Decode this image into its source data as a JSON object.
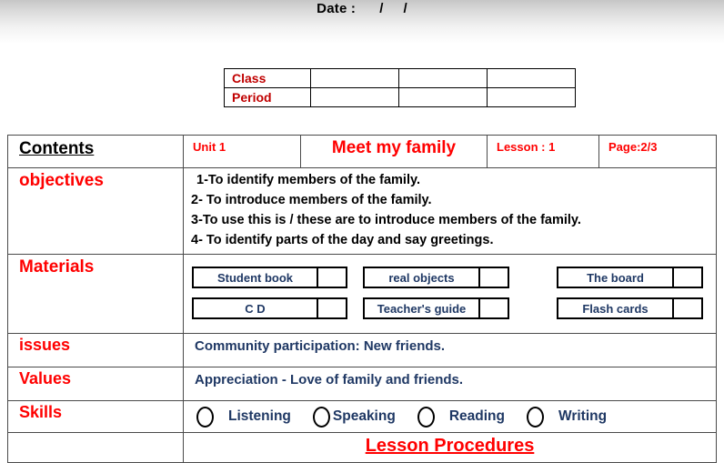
{
  "header": {
    "date_line": "Date :      /     /"
  },
  "class_table": {
    "rows": [
      {
        "label": "Class",
        "values": [
          "",
          "",
          ""
        ]
      },
      {
        "label": "Period",
        "values": [
          "",
          "",
          ""
        ]
      }
    ]
  },
  "lesson_table": {
    "contents_label": "Contents",
    "unit": "Unit 1",
    "title": "Meet my family",
    "lesson": "Lesson : 1",
    "page": "Page:2/3",
    "objectives_label": "objectives",
    "objectives": [
      "1-To identify members of the family.",
      "2- To introduce members of the family.",
      "3-To use this is / these are to introduce members of the family.",
      "4- To identify parts of the day and say greetings."
    ],
    "materials_label": "Materials",
    "materials": [
      {
        "name": "Student book",
        "checked": ""
      },
      {
        "name": "real objects",
        "checked": ""
      },
      {
        "name": "The board",
        "checked": ""
      },
      {
        "name": "C  D",
        "checked": ""
      },
      {
        "name": "Teacher's guide",
        "checked": ""
      },
      {
        "name": "Flash cards",
        "checked": ""
      }
    ],
    "issues_label": "issues",
    "issues_text": "Community participation: New friends.",
    "values_label": "Values",
    "values_text": "Appreciation - Love of family and friends.",
    "skills_label": "Skills",
    "skills": [
      {
        "name": "Listening",
        "checked": ""
      },
      {
        "name": "Speaking",
        "checked": ""
      },
      {
        "name": "Reading",
        "checked": ""
      },
      {
        "name": "Writing",
        "checked": ""
      }
    ],
    "procedures_title": "Lesson Procedures"
  },
  "colors": {
    "red": "#ff0000",
    "dark_red": "#c00000",
    "navy": "#1f3864",
    "black": "#000000",
    "border": "#4a4a4a"
  }
}
